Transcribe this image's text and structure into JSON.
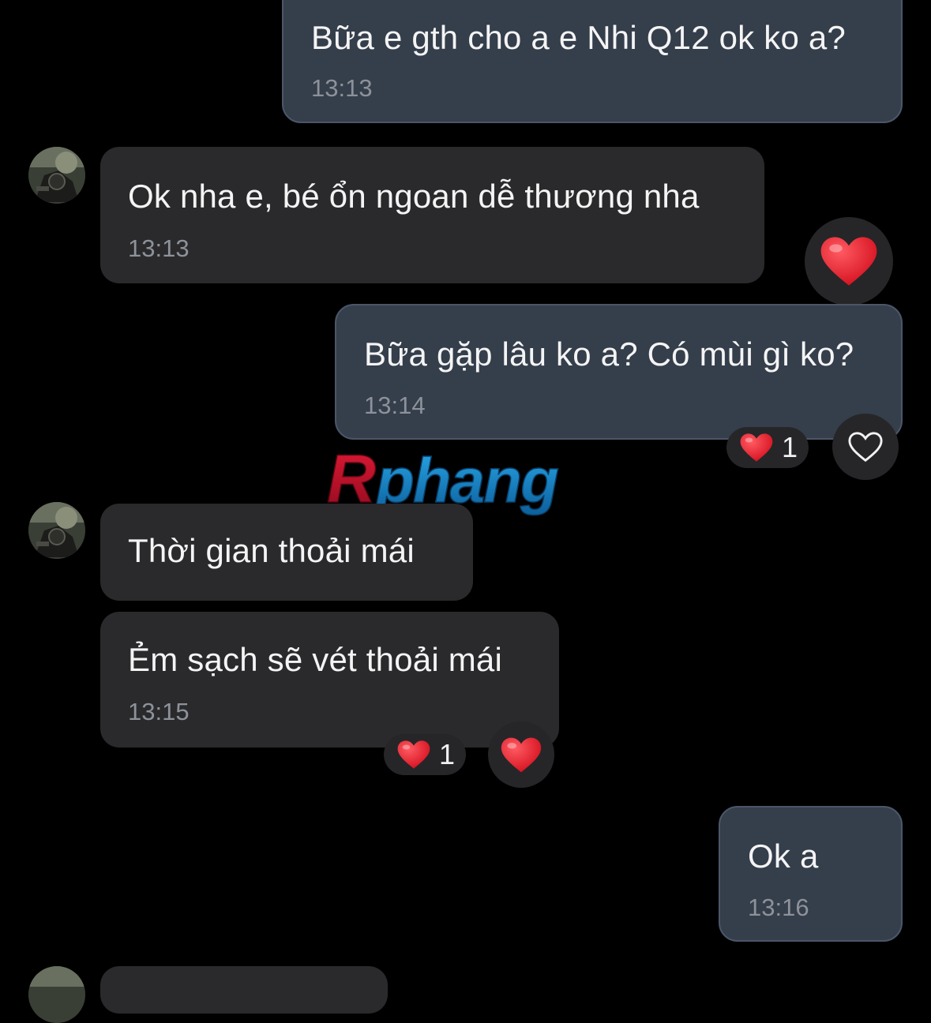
{
  "messages": [
    {
      "direction": "outgoing",
      "text": "Bữa e gth cho a e Nhi Q12 ok ko a?",
      "time": "13:13"
    },
    {
      "direction": "incoming",
      "text": "Ok nha e, bé ổn ngoan dễ thương nha",
      "time": "13:13"
    },
    {
      "direction": "outgoing",
      "text": "Bữa gặp lâu ko a? Có mùi gì ko?",
      "time": "13:14"
    },
    {
      "direction": "incoming",
      "text": "Thời gian thoải mái"
    },
    {
      "direction": "incoming",
      "text": "Ẻm sạch sẽ vét thoải mái",
      "time": "13:15"
    },
    {
      "direction": "outgoing",
      "text": "Ok a",
      "time": "13:16"
    }
  ],
  "reactions": {
    "msg2_reaction": {
      "icon": "heart-emoji"
    },
    "msg3_pill": {
      "icon": "heart-emoji",
      "count": "1"
    },
    "msg3_react_button": {
      "icon": "heart-outline-icon"
    },
    "msg5_pill": {
      "icon": "heart-emoji",
      "count": "1"
    },
    "msg5_reaction": {
      "icon": "heart-emoji"
    }
  },
  "watermark": {
    "text": "Rphang"
  },
  "colors": {
    "background": "#000000",
    "outgoing_bubble": "#353e4b",
    "outgoing_border": "#4b5668",
    "incoming_bubble": "#2a2a2c",
    "timestamp": "#8d929a",
    "heart": "#e8202c",
    "watermark_red": "#c8102e",
    "watermark_blue": "#1a8fd0"
  }
}
